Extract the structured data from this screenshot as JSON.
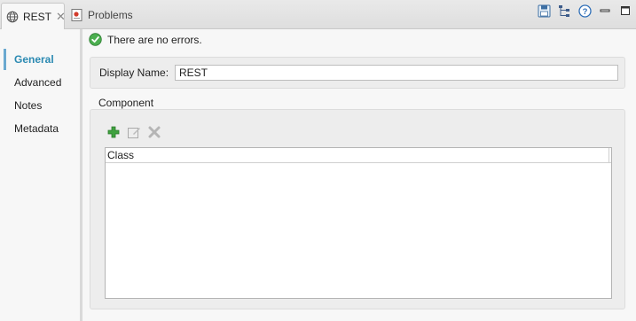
{
  "tabs": [
    {
      "label": "REST",
      "icon": "globe-icon",
      "active": true,
      "closable": true
    },
    {
      "label": "Problems",
      "icon": "problems-icon",
      "active": false
    }
  ],
  "toolbar": {
    "icons": [
      "save-icon",
      "tree-icon",
      "help-icon",
      "minimize-icon",
      "maximize-icon"
    ]
  },
  "sidebar": {
    "items": [
      {
        "label": "General",
        "selected": true
      },
      {
        "label": "Advanced",
        "selected": false
      },
      {
        "label": "Notes",
        "selected": false
      },
      {
        "label": "Metadata",
        "selected": false
      }
    ]
  },
  "status": {
    "message": "There are no errors.",
    "icon": "check-circle-icon"
  },
  "form": {
    "display_name_label": "Display Name:",
    "display_name_value": "REST"
  },
  "component": {
    "title": "Component",
    "toolbar_icons": [
      "add-icon",
      "edit-icon",
      "delete-icon"
    ],
    "table": {
      "columns": [
        "Class"
      ],
      "rows": []
    }
  },
  "colors": {
    "accent": "#2b8ab2",
    "success": "#4caf50",
    "add": "#3fa23f"
  }
}
